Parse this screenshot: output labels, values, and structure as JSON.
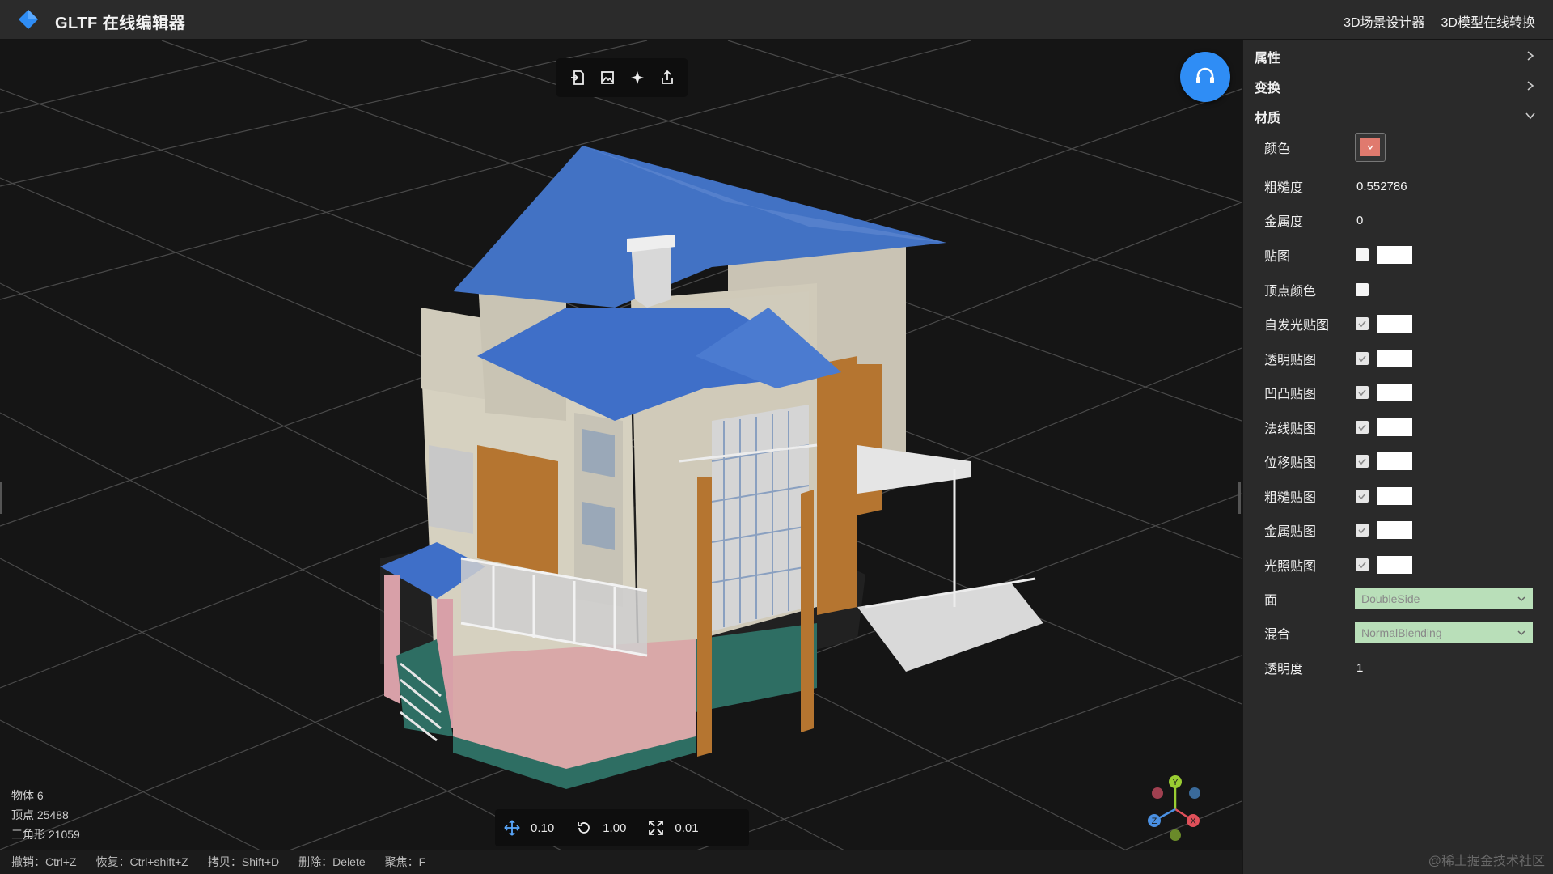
{
  "header": {
    "title": "GLTF 在线编辑器",
    "links": [
      "3D场景设计器",
      "3D模型在线转换"
    ]
  },
  "toolbar": {
    "icons": [
      "import-icon",
      "export-image-icon",
      "light-icon",
      "share-icon"
    ]
  },
  "stats": {
    "objects": "物体 6",
    "vertices": "顶点 25488",
    "triangles": "三角形 21059"
  },
  "transform": {
    "move": "0.10",
    "rotate": "1.00",
    "scale": "0.01"
  },
  "shortcuts": [
    "撤销：Ctrl+Z",
    "恢复：Ctrl+shift+Z",
    "拷贝：Shift+D",
    "删除：Delete",
    "聚焦：F"
  ],
  "panel": {
    "sections": {
      "properties": "属性",
      "transform": "变换",
      "material": "材质"
    },
    "material": {
      "color_label": "颜色",
      "color_value": "#e07a6e",
      "roughness_label": "粗糙度",
      "roughness_value": "0.552786",
      "metalness_label": "金属度",
      "metalness_value": "0",
      "maps": [
        {
          "label": "贴图",
          "checked": false,
          "has_box": true
        },
        {
          "label": "顶点颜色",
          "checked": false,
          "has_box": false
        },
        {
          "label": "自发光贴图",
          "checked": true,
          "has_box": true
        },
        {
          "label": "透明贴图",
          "checked": true,
          "has_box": true
        },
        {
          "label": "凹凸贴图",
          "checked": true,
          "has_box": true
        },
        {
          "label": "法线贴图",
          "checked": true,
          "has_box": true
        },
        {
          "label": "位移贴图",
          "checked": true,
          "has_box": true
        },
        {
          "label": "粗糙贴图",
          "checked": true,
          "has_box": true
        },
        {
          "label": "金属贴图",
          "checked": true,
          "has_box": true
        },
        {
          "label": "光照贴图",
          "checked": true,
          "has_box": true
        }
      ],
      "side_label": "面",
      "side_value": "DoubleSide",
      "blending_label": "混合",
      "blending_value": "NormalBlending",
      "opacity_label": "透明度",
      "opacity_value": "1"
    }
  },
  "axis_gizmo": {
    "x": "X",
    "y": "Y",
    "z": "Z"
  },
  "watermark": "@稀土掘金技术社区",
  "colors": {
    "accent": "#2f8df5",
    "roof": "#4272c4",
    "select_bg": "#b9dfb9"
  }
}
